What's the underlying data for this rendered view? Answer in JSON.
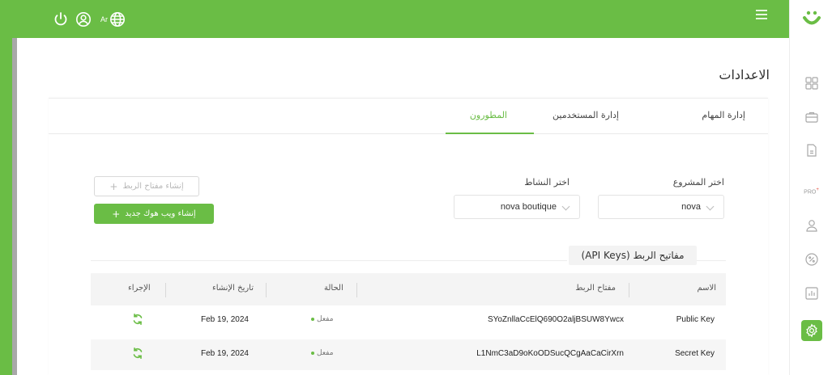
{
  "colors": {
    "accent": "#6abd45"
  },
  "header": {
    "lang_label": "Ar",
    "icons": [
      "power-icon",
      "user-icon",
      "globe-icon",
      "hamburger-icon"
    ]
  },
  "sidebar": {
    "items": [
      {
        "icon": "grid-icon"
      },
      {
        "icon": "briefcase-icon"
      },
      {
        "icon": "document-icon"
      },
      {
        "icon": "pro-icon",
        "label": "PRO"
      },
      {
        "icon": "user-icon"
      },
      {
        "icon": "percent-icon"
      },
      {
        "icon": "chart-icon"
      },
      {
        "icon": "gear-icon",
        "active": true
      }
    ]
  },
  "page": {
    "title": "الاعدادات"
  },
  "tabs": [
    {
      "label": "إدارة المهام"
    },
    {
      "label": "إدارة المستخدمين"
    },
    {
      "label": "المطورون",
      "active": true
    }
  ],
  "form": {
    "project_label": "اختر المشروع",
    "project_value": "nova",
    "activity_label": "اختر النشاط",
    "activity_value": "nova boutique",
    "create_key_button": "إنشاء مفتاح الربط",
    "create_webhook_button": "إنشاء ويب هوك جديد"
  },
  "api_keys": {
    "heading": "مفاتيح الربط (API Keys)",
    "columns": [
      "الاسم",
      "مفتاح الربط",
      "الحالة",
      "تاريخ الإنشاء",
      "الإجراء"
    ],
    "rows": [
      {
        "name": "Public Key",
        "key": "SYoZnllaCcElQ690O2aljBSUW8Ywcx",
        "status": "مفعل",
        "date": "Feb 19, 2024",
        "action_icon": "refresh-icon"
      },
      {
        "name": "Secret Key",
        "key": "L1NmC3aD9oKoODSucQCgAaCaCirXrn",
        "status": "مفعل",
        "date": "Feb 19, 2024",
        "action_icon": "refresh-icon"
      }
    ]
  }
}
